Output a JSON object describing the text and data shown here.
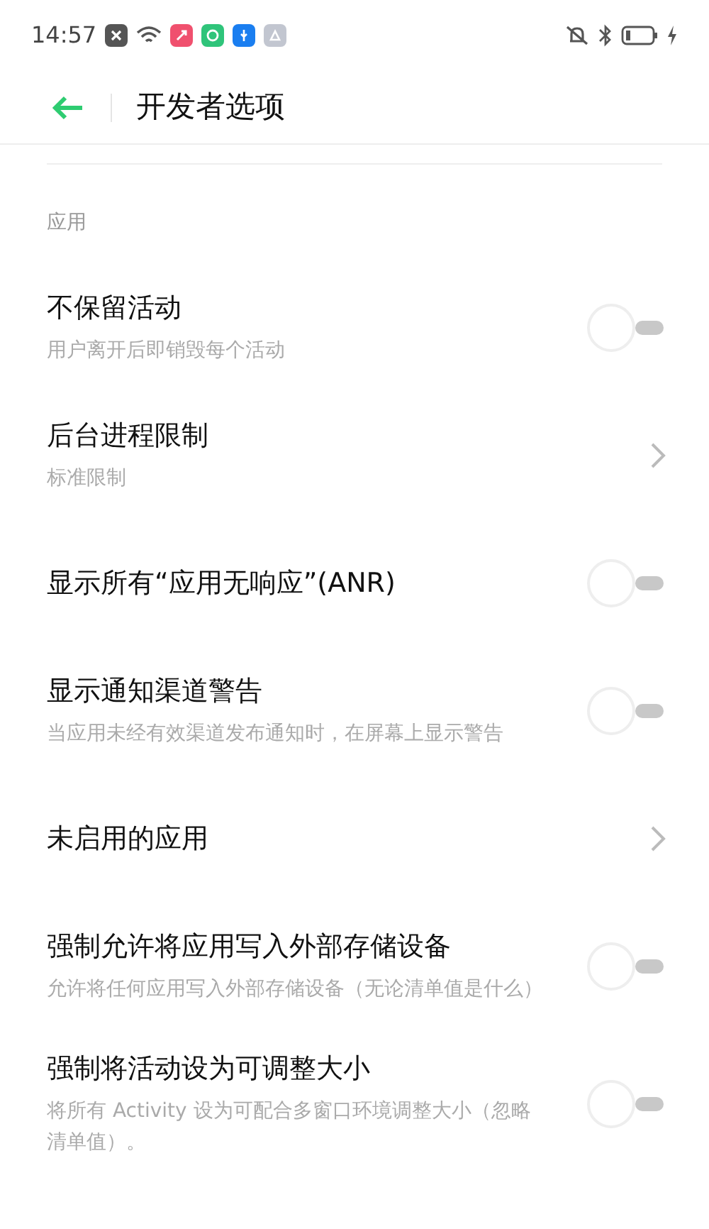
{
  "status_bar": {
    "time": "14:57"
  },
  "header": {
    "title": "开发者选项"
  },
  "section": {
    "title": "应用"
  },
  "items": [
    {
      "kind": "toggle",
      "title": "不保留活动",
      "subtitle": "用户离开后即销毁每个活动",
      "on": false
    },
    {
      "kind": "link",
      "title": "后台进程限制",
      "subtitle": "标准限制"
    },
    {
      "kind": "toggle",
      "title": "显示所有“应用无响应”(ANR)",
      "on": false
    },
    {
      "kind": "toggle",
      "title": "显示通知渠道警告",
      "subtitle": "当应用未经有效渠道发布通知时，在屏幕上显示警告",
      "on": false
    },
    {
      "kind": "link",
      "title": "未启用的应用"
    },
    {
      "kind": "toggle",
      "title": "强制允许将应用写入外部存储设备",
      "subtitle": "允许将任何应用写入外部存储设备（无论清单值是什么）",
      "on": false
    },
    {
      "kind": "toggle",
      "title": "强制将活动设为可调整大小",
      "subtitle": "将所有 Activity 设为可配合多窗口环境调整大小（忽略清单值）。",
      "on": false
    }
  ]
}
